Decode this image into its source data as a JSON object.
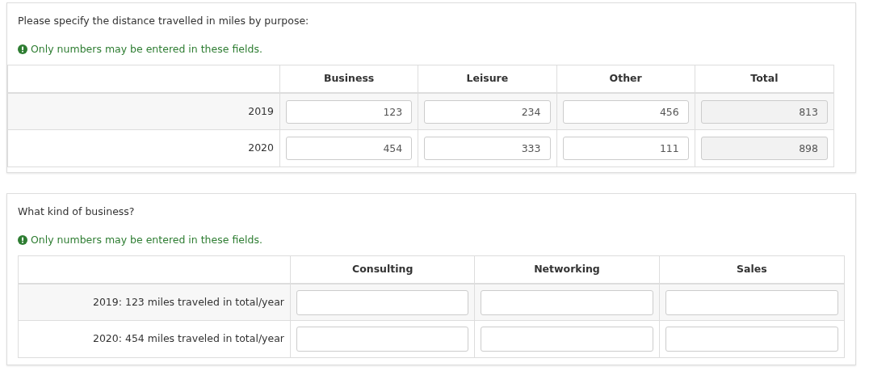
{
  "questions": [
    {
      "text": "Please specify the distance travelled in miles by purpose:",
      "tip": "Only numbers may be entered in these fields.",
      "columns": [
        "Business",
        "Leisure",
        "Other",
        "Total"
      ],
      "rows": [
        {
          "label": "2019",
          "cells": [
            {
              "value": "123",
              "readonly": false
            },
            {
              "value": "234",
              "readonly": false
            },
            {
              "value": "456",
              "readonly": false
            },
            {
              "value": "813",
              "readonly": true
            }
          ]
        },
        {
          "label": "2020",
          "cells": [
            {
              "value": "454",
              "readonly": false
            },
            {
              "value": "333",
              "readonly": false
            },
            {
              "value": "111",
              "readonly": false
            },
            {
              "value": "898",
              "readonly": true
            }
          ]
        }
      ]
    },
    {
      "text": "What kind of business?",
      "tip": "Only numbers may be entered in these fields.",
      "columns": [
        "Consulting",
        "Networking",
        "Sales"
      ],
      "rows": [
        {
          "label": "2019: 123 miles traveled in total/year",
          "cells": [
            {
              "readonly": false
            },
            {
              "readonly": false
            },
            {
              "readonly": false
            }
          ]
        },
        {
          "label": "2020: 454 miles traveled in total/year",
          "cells": [
            {
              "readonly": false
            },
            {
              "readonly": false
            },
            {
              "readonly": false
            }
          ]
        }
      ]
    }
  ]
}
